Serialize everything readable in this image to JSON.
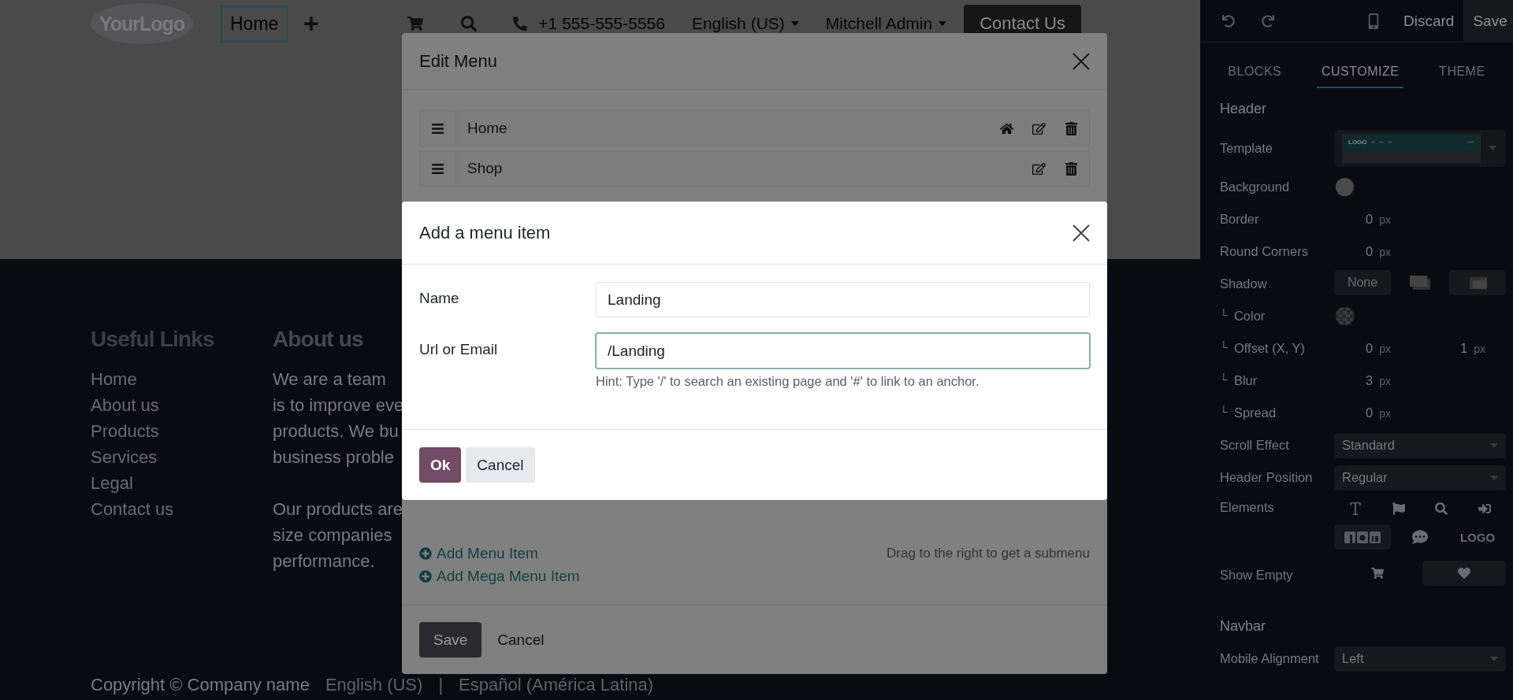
{
  "site_header": {
    "logo": "YourLogo",
    "nav": [
      {
        "label": "Home",
        "selected": true
      }
    ],
    "phone": "+1 555-555-5556",
    "language": "English (US)",
    "user": "Mitchell Admin",
    "cta": "Contact Us"
  },
  "footer": {
    "links_title": "Useful Links",
    "links": [
      "Home",
      "About us",
      "Products",
      "Services",
      "Legal",
      "Contact us"
    ],
    "about_title": "About us",
    "about_paragraphs": [
      [
        "We are a team",
        "is to improve eve",
        "products. We bu",
        "business proble"
      ],
      [
        "Our products are",
        "size companies",
        "performance."
      ]
    ],
    "copyright": "Copyright © Company name",
    "languages": [
      "English (US)",
      "Español (América Latina)"
    ],
    "separator": "|"
  },
  "edit_menu": {
    "title": "Edit Menu",
    "items": [
      {
        "label": "Home",
        "home": true
      },
      {
        "label": "Shop",
        "home": false
      }
    ],
    "add_links": [
      "Add Menu Item",
      "Add Mega Menu Item"
    ],
    "hint": "Drag to the right to get a submenu",
    "buttons": [
      {
        "label": "Save",
        "kind": "primary"
      },
      {
        "label": "Cancel",
        "kind": "secondary"
      }
    ]
  },
  "add_item_dialog": {
    "title": "Add a menu item",
    "fields": [
      {
        "label": "Name",
        "value": "Landing",
        "focused": false
      },
      {
        "label": "Url or Email",
        "value": "/Landing",
        "focused": true,
        "hint": "Hint: Type '/' to search an existing page and '#' to link to an anchor."
      }
    ],
    "buttons": [
      {
        "label": "Ok",
        "kind": "primary"
      },
      {
        "label": "Cancel",
        "kind": "secondary"
      }
    ]
  },
  "editor_panel": {
    "actions": [
      {
        "label": "Discard",
        "kind": "plain"
      },
      {
        "label": "Save",
        "kind": "primary"
      }
    ],
    "tabs": [
      {
        "label": "BLOCKS",
        "selected": false
      },
      {
        "label": "CUSTOMIZE",
        "selected": true
      },
      {
        "label": "THEME",
        "selected": false
      }
    ],
    "sections": [
      {
        "title": "Header",
        "rows": [
          {
            "label": "Template",
            "kind": "template",
            "preview": "LOGO"
          },
          {
            "label": "Background",
            "kind": "color",
            "transparent": false
          },
          {
            "label": "Border",
            "kind": "number",
            "values": [
              {
                "value": "0",
                "unit": "px"
              }
            ]
          },
          {
            "label": "Round Corners",
            "kind": "number",
            "values": [
              {
                "value": "0",
                "unit": "px"
              }
            ]
          },
          {
            "label": "Shadow",
            "kind": "options",
            "options": [
              {
                "kind": "none",
                "label": "None",
                "selected": true
              },
              {
                "kind": "outset",
                "selected": false
              },
              {
                "kind": "inset",
                "selected": true
              }
            ]
          },
          {
            "label": "Color",
            "marker": "└",
            "kind": "color",
            "transparent": true
          },
          {
            "label": "Offset (X, Y)",
            "marker": "└",
            "kind": "number",
            "values": [
              {
                "value": "0",
                "unit": "px"
              },
              {
                "value": "1",
                "unit": "px"
              }
            ]
          },
          {
            "label": "Blur",
            "marker": "└",
            "kind": "number",
            "values": [
              {
                "value": "3",
                "unit": "px"
              }
            ]
          },
          {
            "label": "Spread",
            "marker": "└",
            "kind": "number",
            "values": [
              {
                "value": "0",
                "unit": "px"
              }
            ]
          },
          {
            "label": "Scroll Effect",
            "kind": "select",
            "value": "Standard"
          },
          {
            "label": "Header Position",
            "kind": "select",
            "value": "Regular"
          },
          {
            "label": "Elements",
            "kind": "options",
            "options": [
              {
                "kind": "text",
                "selected": false
              },
              {
                "kind": "flag",
                "selected": false
              },
              {
                "kind": "search",
                "selected": false
              },
              {
                "kind": "sign_in",
                "selected": false
              },
              {
                "kind": "social",
                "selected": true
              },
              {
                "kind": "chat",
                "selected": false
              },
              {
                "kind": "logo",
                "label": "LOGO",
                "selected": false
              }
            ]
          },
          {
            "label": "Show Empty",
            "kind": "options",
            "options": [
              {
                "kind": "cart",
                "selected": false
              },
              {
                "kind": "heart",
                "selected": true
              }
            ]
          }
        ]
      },
      {
        "title": "Navbar",
        "rows": [
          {
            "label": "Mobile Alignment",
            "kind": "select",
            "value": "Left"
          }
        ]
      }
    ]
  }
}
